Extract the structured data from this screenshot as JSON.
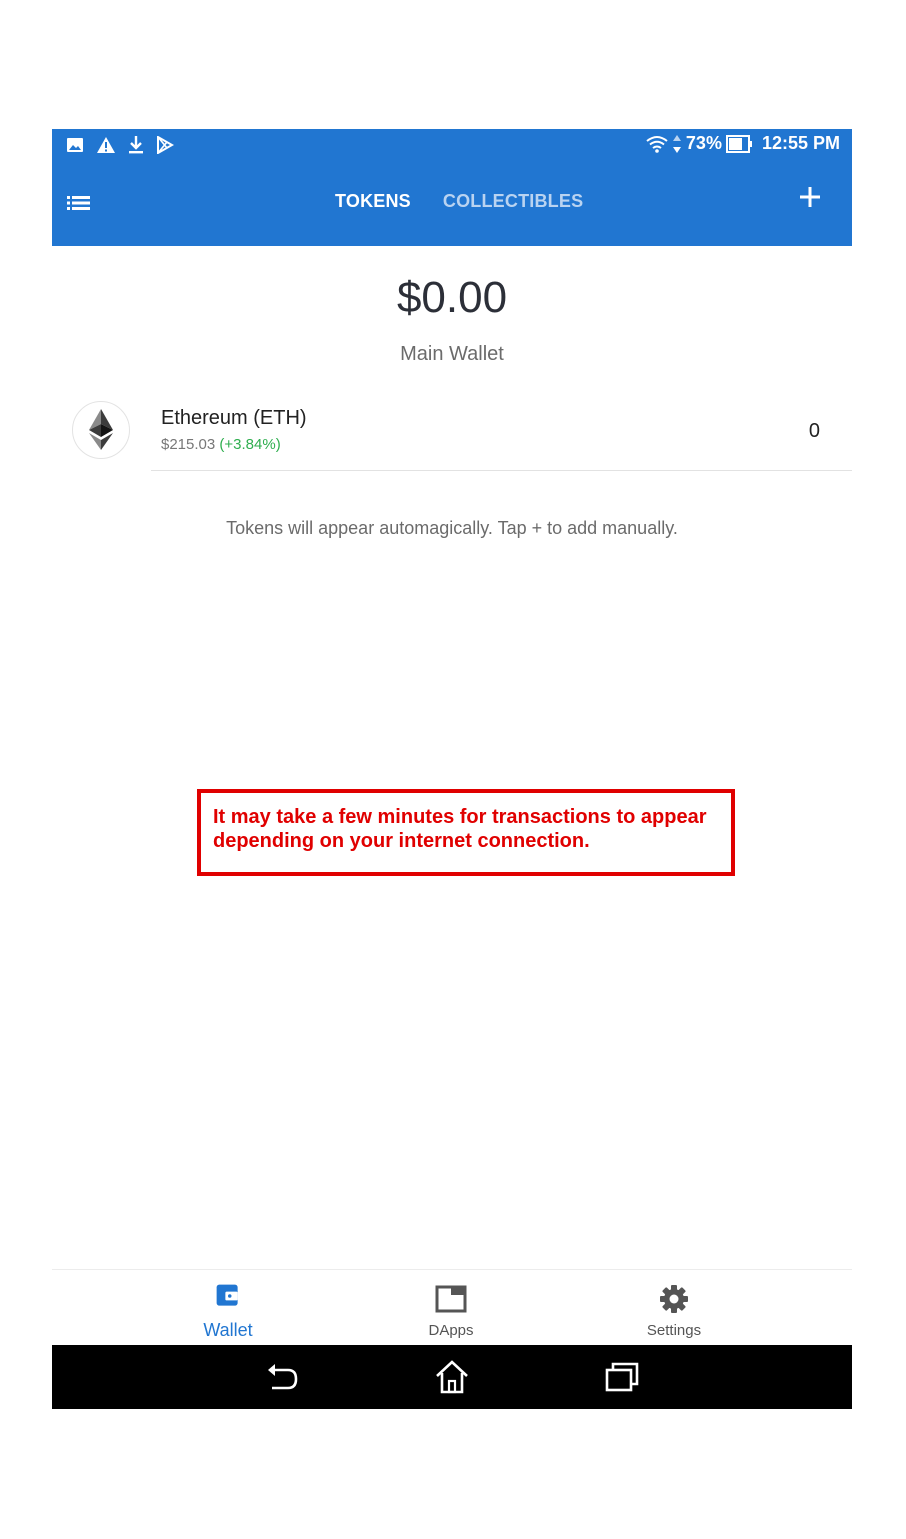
{
  "status_bar": {
    "battery": "73%",
    "time": "12:55 PM"
  },
  "app_bar": {
    "tabs": [
      {
        "label": "TOKENS",
        "active": true
      },
      {
        "label": "COLLECTIBLES",
        "active": false
      }
    ]
  },
  "wallet": {
    "balance": "$0.00",
    "name": "Main Wallet"
  },
  "tokens": [
    {
      "name": "Ethereum (ETH)",
      "price": "$215.03",
      "change": "(+3.84%)",
      "amount": "0",
      "icon": "ethereum-icon"
    }
  ],
  "hint": "Tokens will appear automagically. Tap + to add manually.",
  "notice": {
    "line1": "It may take a few minutes for transactions to appear",
    "line2": "depending on your internet connection."
  },
  "bottom_nav": [
    {
      "label": "Wallet",
      "icon": "wallet-icon",
      "active": true
    },
    {
      "label": "DApps",
      "icon": "browser-window-icon",
      "active": false
    },
    {
      "label": "Settings",
      "icon": "gear-icon",
      "active": false
    }
  ],
  "colors": {
    "primary": "#2176d1",
    "positive": "#2fae4f",
    "notice": "#e00000"
  }
}
